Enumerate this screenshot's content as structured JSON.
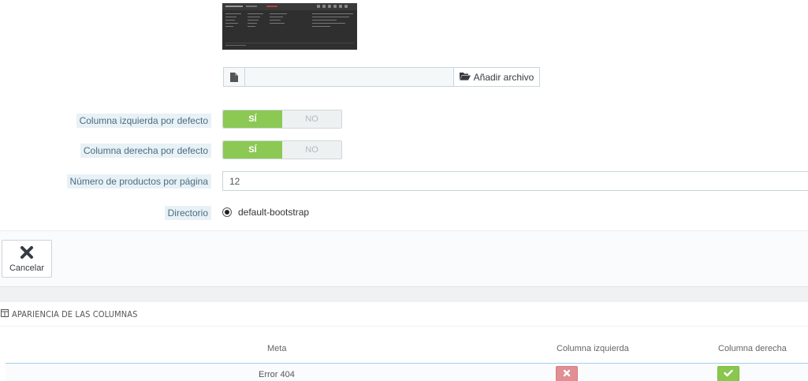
{
  "upload": {
    "button_label": "Añadir archivo"
  },
  "form": {
    "left_column": {
      "label": "Columna izquierda por defecto",
      "on": "SÍ",
      "off": "NO"
    },
    "right_column": {
      "label": "Columna derecha por defecto",
      "on": "SÍ",
      "off": "NO"
    },
    "products_per_page": {
      "label": "Número de productos por página",
      "value": "12"
    },
    "directory": {
      "label": "Directorio",
      "option": "default-bootstrap"
    }
  },
  "footer": {
    "cancel_label": "Cancelar"
  },
  "columns_panel": {
    "title": "APARIENCIA DE LAS COLUMNAS",
    "headers": [
      "Meta",
      "Columna izquierda",
      "Columna derecha"
    ],
    "rows": [
      {
        "meta": "Error 404",
        "left": "disabled",
        "right": "enabled"
      }
    ]
  },
  "colors": {
    "switch_on": "#8bc954",
    "disabled": "#e08f95",
    "enabled": "#8ac74f"
  },
  "icons": {
    "file": "file-icon",
    "folder": "folder-open-icon",
    "close": "close-icon",
    "table": "table-icon",
    "times": "times-icon",
    "check": "check-icon"
  }
}
